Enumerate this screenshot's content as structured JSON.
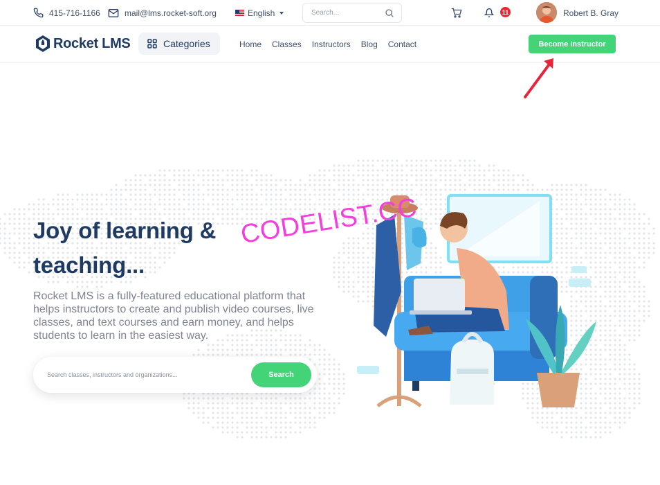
{
  "topbar": {
    "phone": "415-716-1166",
    "email": "mail@lms.rocket-soft.org",
    "language": "English",
    "search_placeholder": "Search...",
    "notification_count": "11",
    "user_name": "Robert B. Gray"
  },
  "nav": {
    "logo_text": "Rocket LMS",
    "categories_label": "Categories",
    "links": [
      "Home",
      "Classes",
      "Instructors",
      "Blog",
      "Contact"
    ],
    "become_instructor_label": "Become instructor"
  },
  "hero": {
    "title": "Joy of learning & teaching...",
    "description": "Rocket LMS is a fully-featured educational platform that helps instructors to create and publish video courses, live classes, and text courses and earn money, and helps students to learn in the easiest way.",
    "search_placeholder": "Search classes, instructors and organizations...",
    "search_button": "Search"
  },
  "watermark": "CODELIST.CC",
  "icons": {
    "phone": "phone-icon",
    "email": "mail-icon",
    "search": "search-icon",
    "cart": "cart-icon",
    "bell": "bell-icon",
    "categories": "grid-icon",
    "arrow": "arrow-annotation"
  },
  "colors": {
    "brand_navy": "#1f3b64",
    "accent_green": "#43d477",
    "badge_red": "#f0232e",
    "watermark_magenta": "#f23fde",
    "annotation_red": "#e8243c"
  }
}
